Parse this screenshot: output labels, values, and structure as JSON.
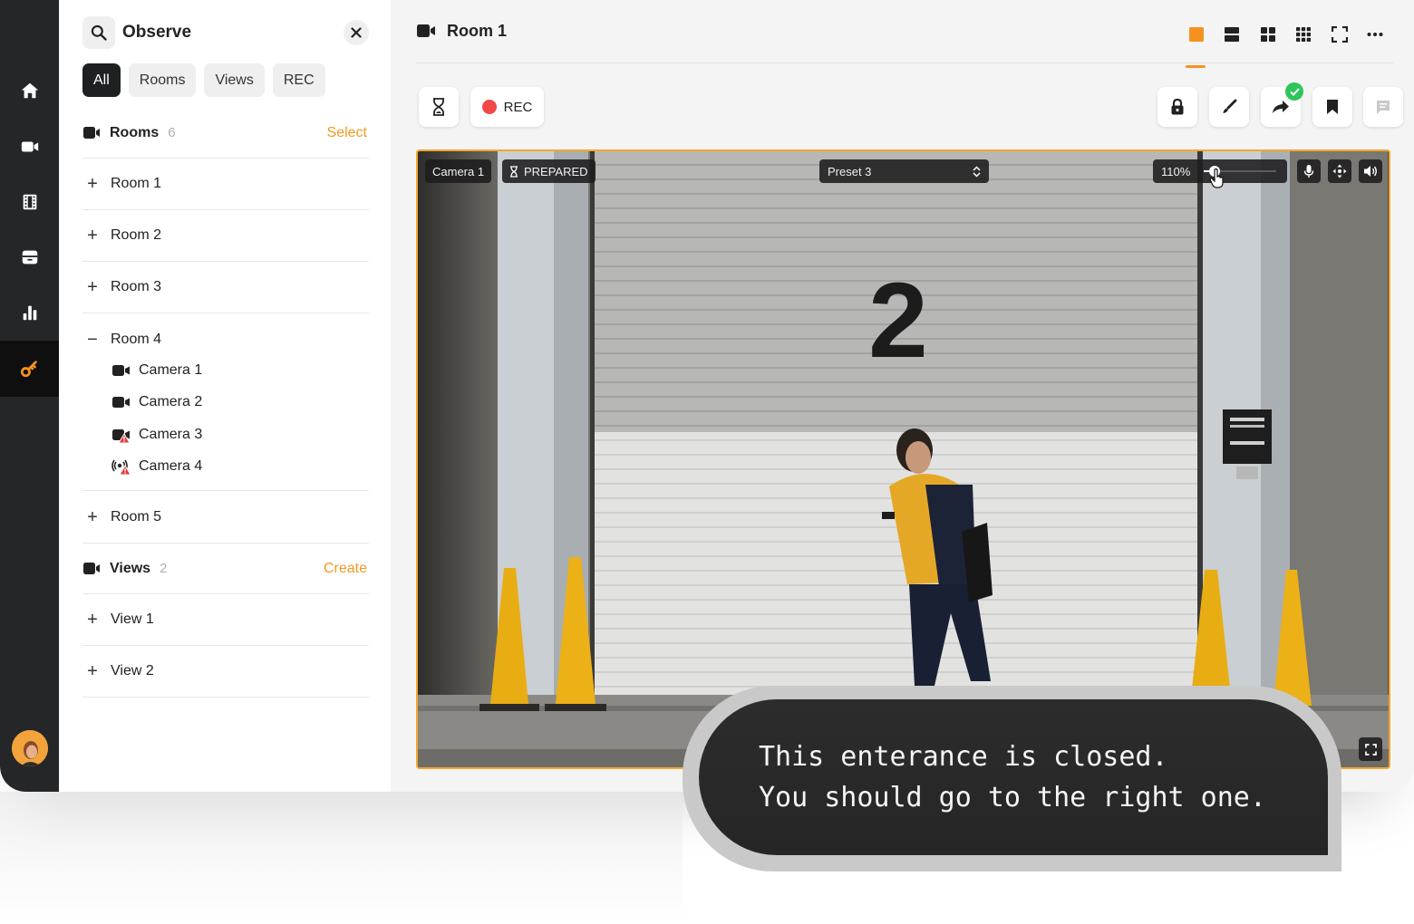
{
  "sidebar": {
    "nav": [
      {
        "icon": "home-icon"
      },
      {
        "icon": "video-camera-icon"
      },
      {
        "icon": "film-icon"
      },
      {
        "icon": "storage-icon"
      },
      {
        "icon": "bar-chart-icon"
      },
      {
        "icon": "key-icon",
        "active": true
      }
    ],
    "avatar_icon": "user-avatar"
  },
  "panel": {
    "title": "Observe",
    "filters": [
      "All",
      "Rooms",
      "Views",
      "REC"
    ],
    "rooms_section": {
      "label": "Rooms",
      "count": "6",
      "action": "Select"
    },
    "rooms": [
      "Room 1",
      "Room 2",
      "Room 3",
      "Room 4",
      "Room 5"
    ],
    "expanded_room": "Room 4",
    "cameras": [
      {
        "label": "Camera 1",
        "status": "ok"
      },
      {
        "label": "Camera 2",
        "status": "ok"
      },
      {
        "label": "Camera 3",
        "status": "warning"
      },
      {
        "label": "Camera 4",
        "status": "signal-warning"
      }
    ],
    "views_section": {
      "label": "Views",
      "count": "2",
      "action": "Create"
    },
    "views": [
      "View 1",
      "View 2"
    ],
    "sign_expand": "+",
    "sign_collapse": "−"
  },
  "main": {
    "room_title": "Room 1",
    "layouts": [
      "single",
      "two-rows",
      "grid-2x2",
      "grid-3x3",
      "fullscreen",
      "more"
    ],
    "toolbar": {
      "rec_label": "REC"
    },
    "video": {
      "camera_label": "Camera 1",
      "status_label": "PREPARED",
      "preset_label": "Preset 3",
      "zoom_label": "110%",
      "zoom_fraction": 0.15,
      "door_number": "2"
    }
  },
  "caption": {
    "line1": "This enterance is closed.",
    "line2": "You should go to the right one."
  },
  "colors": {
    "accent": "#f5921f",
    "rail": "#252628",
    "rec": "#f24848",
    "success": "#2ec55a"
  }
}
